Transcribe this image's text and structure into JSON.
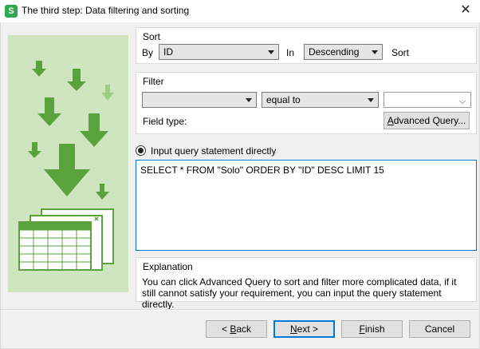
{
  "window": {
    "title": "The third step: Data filtering and sorting",
    "app_icon_letter": "S",
    "close_glyph": "✕"
  },
  "sort": {
    "group_label": "Sort",
    "by_label": "By",
    "by_value": "ID",
    "in_label": "In",
    "order_value": "Descending",
    "suffix_label": "Sort"
  },
  "filter": {
    "group_label": "Filter",
    "field_value": "",
    "operator_value": "equal to",
    "value_value": "",
    "field_type_label": "Field type:",
    "advanced_query_label": "Advanced Query..."
  },
  "query": {
    "radio_label": "Input query statement directly",
    "statement": "SELECT * FROM \"Solo\"  ORDER BY \"ID\" DESC LIMIT 15"
  },
  "explanation": {
    "group_label": "Explanation",
    "text": "You can click Advanced Query to sort and filter more complicated data, if it still cannot satisfy your requirement, you can input the query statement directly."
  },
  "footer": {
    "back_label": "< Back",
    "next_label": "Next >",
    "finish_label": "Finish",
    "cancel_label": "Cancel"
  },
  "colors": {
    "accent": "#0078d7",
    "illustration_bg": "#cfe5bf",
    "arrow_green": "#5aa23c"
  }
}
